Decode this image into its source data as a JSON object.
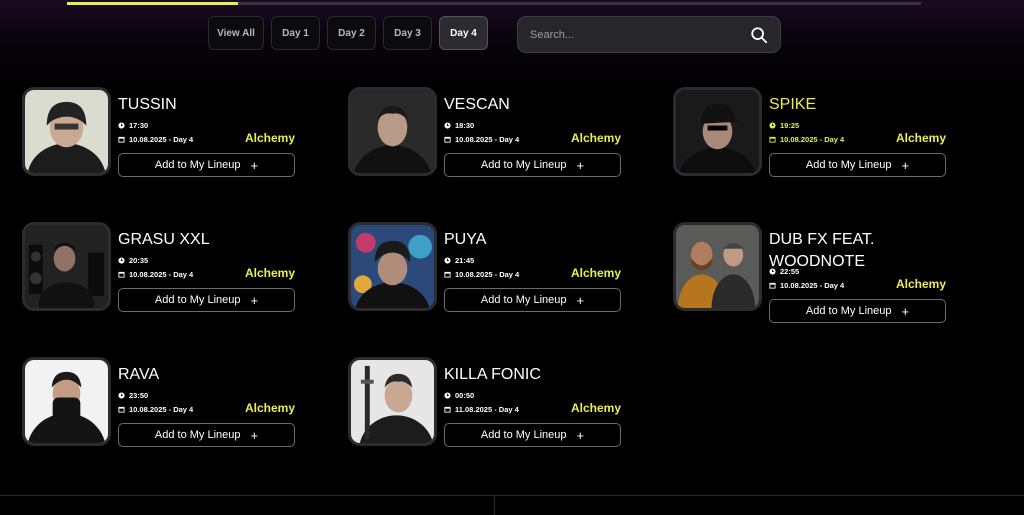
{
  "progress": 0.2,
  "tabs": [
    {
      "label": "View All",
      "active": false
    },
    {
      "label": "Day 1",
      "active": false
    },
    {
      "label": "Day 2",
      "active": false
    },
    {
      "label": "Day 3",
      "active": false
    },
    {
      "label": "Day 4",
      "active": true
    }
  ],
  "search": {
    "placeholder": "Search...",
    "value": ""
  },
  "add_label": "Add to My Lineup",
  "accent": "#e7ef53",
  "artists": [
    {
      "name": "TUSSIN",
      "time": "17:30",
      "date": "10.08.2025 - Day 4",
      "stage": "Alchemy",
      "highlight": false
    },
    {
      "name": "VESCAN",
      "time": "18:30",
      "date": "10.08.2025 - Day 4",
      "stage": "Alchemy",
      "highlight": false
    },
    {
      "name": "SPIKE",
      "time": "19:25",
      "date": "10.08.2025 - Day 4",
      "stage": "Alchemy",
      "highlight": true
    },
    {
      "name": "GRASU XXL",
      "time": "20:35",
      "date": "10.08.2025 - Day 4",
      "stage": "Alchemy",
      "highlight": false
    },
    {
      "name": "PUYA",
      "time": "21:45",
      "date": "10.08.2025 - Day 4",
      "stage": "Alchemy",
      "highlight": false
    },
    {
      "name": "DUB FX FEAT. WOODNOTE",
      "time": "22:55",
      "date": "10.08.2025 - Day 4",
      "stage": "Alchemy",
      "highlight": false
    },
    {
      "name": "RAVA",
      "time": "23:50",
      "date": "10.08.2025 - Day 4",
      "stage": "Alchemy",
      "highlight": false
    },
    {
      "name": "KILLA FONIC",
      "time": "00:50",
      "date": "11.08.2025 - Day 4",
      "stage": "Alchemy",
      "highlight": false
    }
  ]
}
